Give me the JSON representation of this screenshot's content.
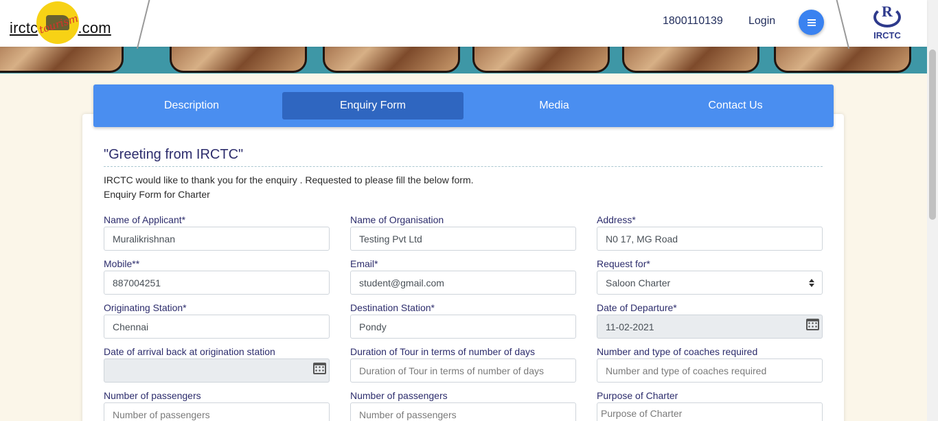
{
  "header": {
    "brand_left": "irctc",
    "brand_script": "tourism",
    "brand_right": ".com",
    "phone": "1800110139",
    "login": "Login",
    "irctc_label": "IRCTC"
  },
  "tabs": [
    {
      "label": "Description"
    },
    {
      "label": "Enquiry Form"
    },
    {
      "label": "Media"
    },
    {
      "label": "Contact Us"
    }
  ],
  "form": {
    "greeting": "\"Greeting from IRCTC\"",
    "intro": "IRCTC would like to thank you for the enquiry . Requested to please fill the below form.",
    "subintro": "Enquiry Form for Charter",
    "fields": [
      {
        "label": "Name of Applicant*",
        "value": "Muralikrishnan",
        "placeholder": ""
      },
      {
        "label": "Name of Organisation",
        "value": "Testing Pvt Ltd",
        "placeholder": ""
      },
      {
        "label": "Address*",
        "value": "N0 17, MG Road",
        "placeholder": ""
      },
      {
        "label": "Mobile**",
        "value": "887004251",
        "placeholder": ""
      },
      {
        "label": "Email*",
        "value": "student@gmail.com",
        "placeholder": ""
      },
      {
        "label": "Request for*",
        "value": "Saloon Charter",
        "placeholder": ""
      },
      {
        "label": "Originating Station*",
        "value": "Chennai",
        "placeholder": ""
      },
      {
        "label": "Destination Station*",
        "value": "Pondy",
        "placeholder": ""
      },
      {
        "label": "Date of Departure*",
        "value": "11-02-2021",
        "placeholder": ""
      },
      {
        "label": "Date of arrival back at origination station",
        "value": "",
        "placeholder": ""
      },
      {
        "label": "Duration of Tour in terms of number of days",
        "value": "",
        "placeholder": "Duration of Tour in terms of number of days"
      },
      {
        "label": "Number and type of coaches required",
        "value": "",
        "placeholder": "Number and type of coaches required"
      },
      {
        "label": "Number of passengers",
        "value": "",
        "placeholder": "Number of passengers"
      },
      {
        "label": "Number of passengers",
        "value": "",
        "placeholder": "Number of passengers"
      },
      {
        "label": "Purpose of Charter",
        "value": "",
        "placeholder": "Purpose of Charter"
      }
    ]
  },
  "colors": {
    "tab_bar": "#4a8ef0",
    "tab_active": "#2f66c0",
    "label_text": "#2c2c6c",
    "menu_button": "#3a82f0",
    "page_bg": "#fbf6e9"
  },
  "icons": {
    "menu": "hamburger-icon",
    "calendar": "calendar-icon",
    "select": "select-arrows-icon"
  }
}
